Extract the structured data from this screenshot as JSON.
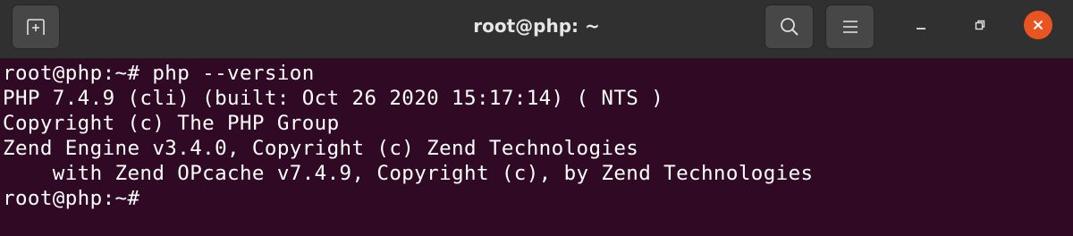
{
  "titlebar": {
    "title": "root@php: ~",
    "icons": {
      "new_tab": "new-tab-icon",
      "search": "search-icon",
      "menu": "hamburger-menu-icon",
      "minimize": "minimize-icon",
      "maximize": "maximize-icon",
      "close": "close-icon"
    }
  },
  "terminal": {
    "lines": [
      "root@php:~# php --version",
      "PHP 7.4.9 (cli) (built: Oct 26 2020 15:17:14) ( NTS )",
      "Copyright (c) The PHP Group",
      "Zend Engine v3.4.0, Copyright (c) Zend Technologies",
      "    with Zend OPcache v7.4.9, Copyright (c), by Zend Technologies",
      "root@php:~# "
    ]
  },
  "colors": {
    "terminal_bg": "#300a24",
    "titlebar_bg": "#303030",
    "close_accent": "#e95420",
    "text": "#ffffff"
  }
}
